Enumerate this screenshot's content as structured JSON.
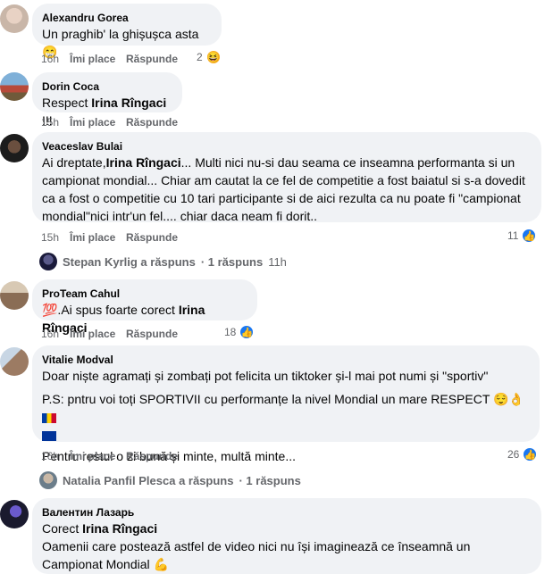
{
  "comments": [
    {
      "author": "Alexandru Gorea",
      "text": "Un praghib' la ghișușca asta 😁",
      "time": "16h",
      "like_label": "Îmi place",
      "reply_label": "Răspunde",
      "reactions": "2"
    },
    {
      "author": "Dorin Coca",
      "text_pre": "Respect ",
      "mention": "Irina Rîngaci",
      "text_post": " !!!",
      "time": "15h",
      "like_label": "Îmi place",
      "reply_label": "Răspunde"
    },
    {
      "author": "Veaceslav Bulai",
      "text_pre": "Ai dreptate,",
      "mention": "Irina Rîngaci",
      "text_post": "... Multi nici nu-si dau seama ce inseamna performanta si un campionat mondial... Chiar am cautat la ce fel de competitie a fost baiatul si s-a dovedit ca a fost o competitie cu 10 tari participante si de aici rezulta ca nu poate fi \"campionat mondial\"nici intr'un fel.... chiar daca neam fi dorit..",
      "time": "15h",
      "like_label": "Îmi place",
      "reply_label": "Răspunde",
      "reactions": "11",
      "replies": {
        "who": "Stepan Kyrlig a răspuns",
        "count": "· 1 răspuns",
        "ago": "11h"
      }
    },
    {
      "author": "ProTeam Cahul",
      "text_pre": "💯.Ai spus foarte corect ",
      "mention": "Irina Rîngaci",
      "time": "16h",
      "like_label": "Îmi place",
      "reply_label": "Răspunde",
      "reactions": "18"
    },
    {
      "author": "Vitalie Modval",
      "para1": "Doar niște agramați și zombați pot felicita un tiktoker și-l mai pot numi și \"sportiv\"",
      "para2": "P.S: pntru voi toți SPORTIVII cu performanțe la nivel Mondial un mare RESPECT 😌👌",
      "para3": "Pentru restul o zi bună și minte, multă minte...",
      "time": "16h",
      "like_label": "Îmi place",
      "reply_label": "Răspunde",
      "reactions": "26",
      "replies": {
        "who": "Natalia Panfil Plesca a răspuns",
        "count": "· 1 răspuns"
      }
    },
    {
      "author": "Валентин Лазарь",
      "text_pre": "Corect ",
      "mention": "Irina Rîngaci",
      "para2": "Oamenii care postează astfel de video nici nu își imaginează ce înseamnă un Campionat Mondial 💪"
    }
  ],
  "colors": {
    "bubble": "#f0f2f5",
    "meta": "#65676b",
    "like_blue": "#1877f2"
  }
}
